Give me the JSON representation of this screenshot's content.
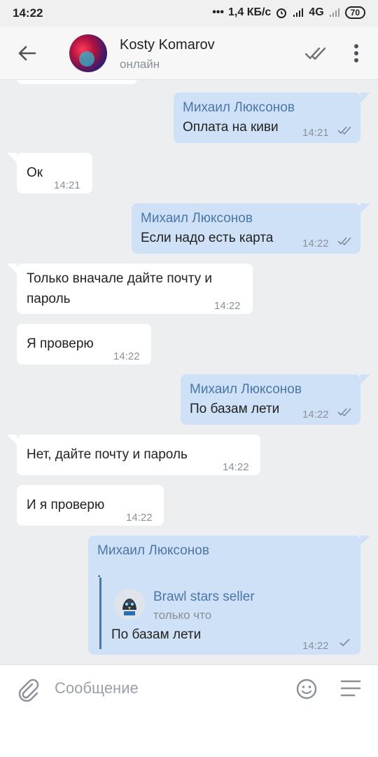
{
  "status_bar": {
    "time": "14:22",
    "net_speed": "1,4 КБ/с",
    "network": "4G",
    "battery": "70"
  },
  "header": {
    "contact_name": "Kosty Komarov",
    "contact_status": "онлайн"
  },
  "messages": [
    {
      "direction": "out",
      "sender": "Михаил Люксонов",
      "text": "Оплата на киви",
      "time": "14:21",
      "status": "read"
    },
    {
      "direction": "in",
      "text": "Ок",
      "time": "14:21"
    },
    {
      "direction": "out",
      "sender": "Михаил Люксонов",
      "text": "Если надо есть карта",
      "time": "14:22",
      "status": "read"
    },
    {
      "direction": "in",
      "text_line1": "Только вначале дайте почту и",
      "text_line2": "пароль",
      "time": "14:22"
    },
    {
      "direction": "in",
      "text": "Я проверю",
      "time": "14:22"
    },
    {
      "direction": "out",
      "sender": "Михаил Люксонов",
      "text": "По базам лети",
      "time": "14:22",
      "status": "read"
    },
    {
      "direction": "in",
      "text": "Нет, дайте почту и пароль",
      "time": "14:22"
    },
    {
      "direction": "in",
      "text": "И я проверю",
      "time": "14:22"
    },
    {
      "direction": "out",
      "sender": "Михаил Люксонов",
      "text": ".",
      "time": "14:22",
      "status": "sent",
      "forwarded": {
        "author": "Brawl stars seller",
        "when": "только что",
        "text": "По базам лети"
      }
    }
  ],
  "composer": {
    "placeholder": "Сообщение"
  },
  "icons": {
    "back": "arrow-left-icon",
    "read": "double-check-icon",
    "more": "more-vertical-icon",
    "attach": "paperclip-icon",
    "emoji": "emoji-icon",
    "menu": "menu-lines-icon"
  },
  "colors": {
    "accent": "#4a76a8",
    "outgoing_bubble": "#cfe1f6",
    "incoming_bubble": "#ffffff",
    "background": "#edeef0"
  }
}
